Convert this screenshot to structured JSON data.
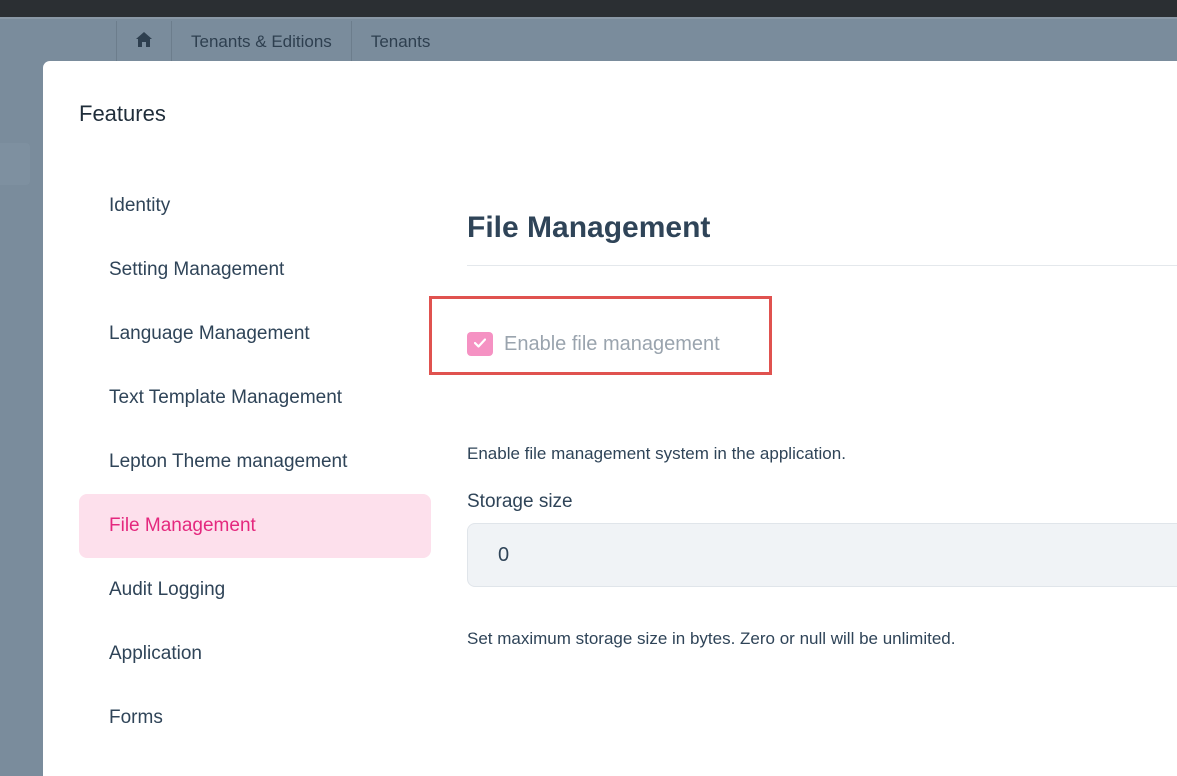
{
  "breadcrumb": {
    "home_icon": "home-icon",
    "items": [
      "Tenants & Editions",
      "Tenants"
    ]
  },
  "modal": {
    "title": "Features"
  },
  "nav": {
    "items": [
      {
        "label": "Identity"
      },
      {
        "label": "Setting Management"
      },
      {
        "label": "Language Management"
      },
      {
        "label": "Text Template Management"
      },
      {
        "label": "Lepton Theme management"
      },
      {
        "label": "File Management",
        "active": true
      },
      {
        "label": "Audit Logging"
      },
      {
        "label": "Application"
      },
      {
        "label": "Forms"
      }
    ]
  },
  "content": {
    "title": "File Management",
    "enable_checkbox": {
      "label": "Enable file management",
      "checked": true,
      "icon": "check-icon"
    },
    "enable_description": "Enable file management system in the application.",
    "storage_label": "Storage size",
    "storage_value": "0",
    "storage_description": "Set maximum storage size in bytes. Zero or null will be unlimited."
  },
  "colors": {
    "accent": "#e4287e",
    "active_bg": "#fde0ec",
    "checkbox": "#f592c3",
    "highlight_box": "#e0524f"
  }
}
